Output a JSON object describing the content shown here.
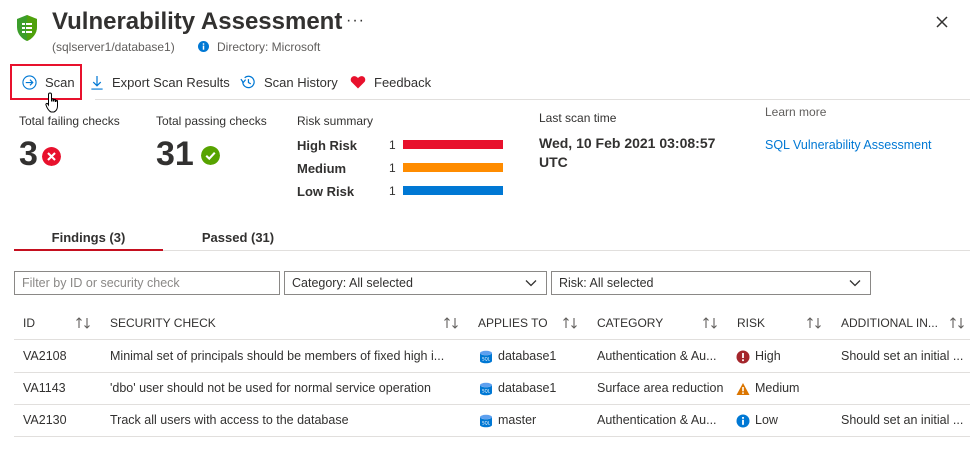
{
  "header": {
    "title": "Vulnerability Assessment",
    "subtitle": "(sqlserver1/database1)",
    "directory": "Directory: Microsoft",
    "more_label": "···"
  },
  "toolbar": {
    "scan_label": "Scan",
    "export_label": "Export Scan Results",
    "history_label": "Scan History",
    "feedback_label": "Feedback"
  },
  "summary": {
    "failing_label": "Total failing checks",
    "failing_count": "3",
    "passing_label": "Total passing checks",
    "passing_count": "31",
    "risk_label": "Risk summary",
    "risks": [
      {
        "name": "High Risk",
        "count": "1",
        "color": "#e8112d"
      },
      {
        "name": "Medium",
        "count": "1",
        "color": "#ff8c00"
      },
      {
        "name": "Low Risk",
        "count": "1",
        "color": "#0078d4"
      }
    ],
    "last_scan_label": "Last scan time",
    "last_scan_value": "Wed, 10 Feb 2021 03:08:57 UTC",
    "learn_more_label": "Learn more",
    "learn_more_link": "SQL Vulnerability Assessment"
  },
  "tabs": [
    {
      "label": "Findings (3)"
    },
    {
      "label": "Passed (31)"
    }
  ],
  "filters": {
    "search_placeholder": "Filter by ID or security check",
    "category": "Category: All selected",
    "risk": "Risk: All selected"
  },
  "table": {
    "columns": [
      "ID",
      "SECURITY CHECK",
      "APPLIES TO",
      "CATEGORY",
      "RISK",
      "ADDITIONAL IN..."
    ],
    "rows": [
      {
        "id": "VA2108",
        "check": "Minimal set of principals should be members of fixed high i...",
        "applies": "database1",
        "category": "Authentication & Au...",
        "risk": "High",
        "additional": "Should set an initial ..."
      },
      {
        "id": "VA1143",
        "check": "'dbo' user should not be used for normal service operation",
        "applies": "database1",
        "category": "Surface area reduction",
        "risk": "Medium",
        "additional": ""
      },
      {
        "id": "VA2130",
        "check": "Track all users with access to the database",
        "applies": "master",
        "category": "Authentication & Au...",
        "risk": "Low",
        "additional": "Should set an initial ..."
      }
    ]
  },
  "colors": {
    "accent": "#0078d4",
    "high": "#e8112d",
    "medium": "#ff8c00",
    "low": "#0078d4",
    "pass": "#57a300"
  }
}
